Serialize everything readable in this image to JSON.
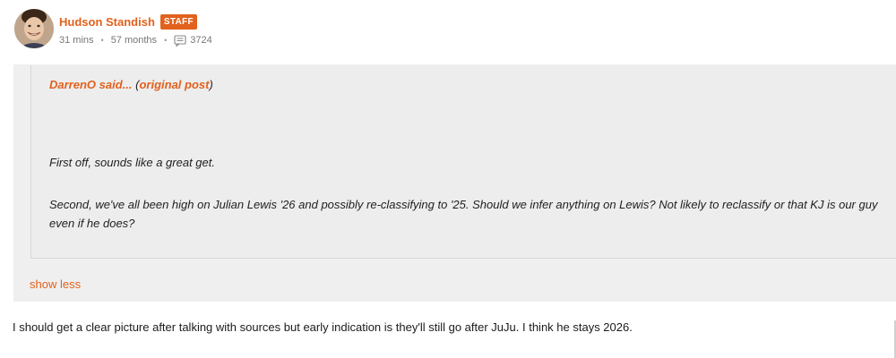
{
  "post": {
    "author": "Hudson Standish",
    "badge": "STAFF",
    "time_ago": "31 mins",
    "membership": "57 months",
    "post_count": "3724",
    "icons": {
      "avatar": "user-avatar",
      "posts": "comments-icon"
    },
    "accent_color": "#e2611d"
  },
  "quote": {
    "author": "DarrenO",
    "said_label": "said...",
    "open_paren": " (",
    "link_label": "original post",
    "close_paren": ")",
    "paragraphs": [
      "First off, sounds like a great get.",
      "Second, we've all been high on Julian Lewis '26 and possibly re-classifying to '25. Should we infer anything on Lewis? Not likely to reclassify or that KJ is our guy even if he does?"
    ],
    "toggle_label": "show less"
  },
  "reply": {
    "text": "I should get a clear picture after talking with sources but early indication is they'll still go after JuJu. I think he stays 2026."
  }
}
